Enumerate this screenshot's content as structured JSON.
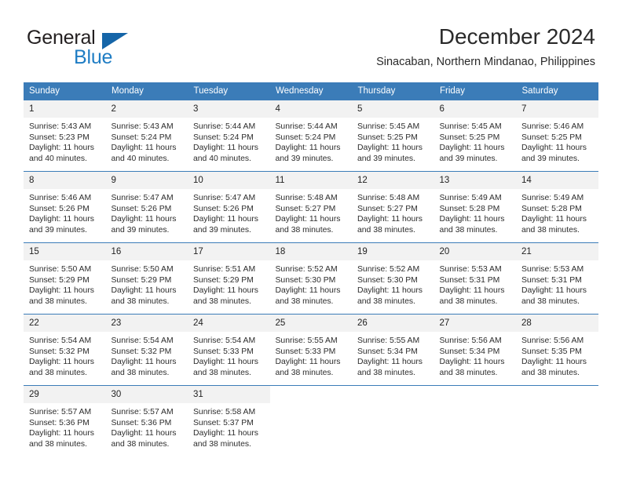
{
  "brand": {
    "name_part1": "General",
    "name_part2": "Blue",
    "accent_color": "#1f7dc4",
    "triangle_color": "#1565a8"
  },
  "header": {
    "title": "December 2024",
    "subtitle": "Sinacaban, Northern Mindanao, Philippines"
  },
  "calendar": {
    "header_bg": "#3b7cb8",
    "daynum_bg": "#f2f2f2",
    "weekday_headers": [
      "Sunday",
      "Monday",
      "Tuesday",
      "Wednesday",
      "Thursday",
      "Friday",
      "Saturday"
    ],
    "weeks": [
      [
        {
          "day": "1",
          "sunrise": "Sunrise: 5:43 AM",
          "sunset": "Sunset: 5:23 PM",
          "daylight1": "Daylight: 11 hours",
          "daylight2": "and 40 minutes."
        },
        {
          "day": "2",
          "sunrise": "Sunrise: 5:43 AM",
          "sunset": "Sunset: 5:24 PM",
          "daylight1": "Daylight: 11 hours",
          "daylight2": "and 40 minutes."
        },
        {
          "day": "3",
          "sunrise": "Sunrise: 5:44 AM",
          "sunset": "Sunset: 5:24 PM",
          "daylight1": "Daylight: 11 hours",
          "daylight2": "and 40 minutes."
        },
        {
          "day": "4",
          "sunrise": "Sunrise: 5:44 AM",
          "sunset": "Sunset: 5:24 PM",
          "daylight1": "Daylight: 11 hours",
          "daylight2": "and 39 minutes."
        },
        {
          "day": "5",
          "sunrise": "Sunrise: 5:45 AM",
          "sunset": "Sunset: 5:25 PM",
          "daylight1": "Daylight: 11 hours",
          "daylight2": "and 39 minutes."
        },
        {
          "day": "6",
          "sunrise": "Sunrise: 5:45 AM",
          "sunset": "Sunset: 5:25 PM",
          "daylight1": "Daylight: 11 hours",
          "daylight2": "and 39 minutes."
        },
        {
          "day": "7",
          "sunrise": "Sunrise: 5:46 AM",
          "sunset": "Sunset: 5:25 PM",
          "daylight1": "Daylight: 11 hours",
          "daylight2": "and 39 minutes."
        }
      ],
      [
        {
          "day": "8",
          "sunrise": "Sunrise: 5:46 AM",
          "sunset": "Sunset: 5:26 PM",
          "daylight1": "Daylight: 11 hours",
          "daylight2": "and 39 minutes."
        },
        {
          "day": "9",
          "sunrise": "Sunrise: 5:47 AM",
          "sunset": "Sunset: 5:26 PM",
          "daylight1": "Daylight: 11 hours",
          "daylight2": "and 39 minutes."
        },
        {
          "day": "10",
          "sunrise": "Sunrise: 5:47 AM",
          "sunset": "Sunset: 5:26 PM",
          "daylight1": "Daylight: 11 hours",
          "daylight2": "and 39 minutes."
        },
        {
          "day": "11",
          "sunrise": "Sunrise: 5:48 AM",
          "sunset": "Sunset: 5:27 PM",
          "daylight1": "Daylight: 11 hours",
          "daylight2": "and 38 minutes."
        },
        {
          "day": "12",
          "sunrise": "Sunrise: 5:48 AM",
          "sunset": "Sunset: 5:27 PM",
          "daylight1": "Daylight: 11 hours",
          "daylight2": "and 38 minutes."
        },
        {
          "day": "13",
          "sunrise": "Sunrise: 5:49 AM",
          "sunset": "Sunset: 5:28 PM",
          "daylight1": "Daylight: 11 hours",
          "daylight2": "and 38 minutes."
        },
        {
          "day": "14",
          "sunrise": "Sunrise: 5:49 AM",
          "sunset": "Sunset: 5:28 PM",
          "daylight1": "Daylight: 11 hours",
          "daylight2": "and 38 minutes."
        }
      ],
      [
        {
          "day": "15",
          "sunrise": "Sunrise: 5:50 AM",
          "sunset": "Sunset: 5:29 PM",
          "daylight1": "Daylight: 11 hours",
          "daylight2": "and 38 minutes."
        },
        {
          "day": "16",
          "sunrise": "Sunrise: 5:50 AM",
          "sunset": "Sunset: 5:29 PM",
          "daylight1": "Daylight: 11 hours",
          "daylight2": "and 38 minutes."
        },
        {
          "day": "17",
          "sunrise": "Sunrise: 5:51 AM",
          "sunset": "Sunset: 5:29 PM",
          "daylight1": "Daylight: 11 hours",
          "daylight2": "and 38 minutes."
        },
        {
          "day": "18",
          "sunrise": "Sunrise: 5:52 AM",
          "sunset": "Sunset: 5:30 PM",
          "daylight1": "Daylight: 11 hours",
          "daylight2": "and 38 minutes."
        },
        {
          "day": "19",
          "sunrise": "Sunrise: 5:52 AM",
          "sunset": "Sunset: 5:30 PM",
          "daylight1": "Daylight: 11 hours",
          "daylight2": "and 38 minutes."
        },
        {
          "day": "20",
          "sunrise": "Sunrise: 5:53 AM",
          "sunset": "Sunset: 5:31 PM",
          "daylight1": "Daylight: 11 hours",
          "daylight2": "and 38 minutes."
        },
        {
          "day": "21",
          "sunrise": "Sunrise: 5:53 AM",
          "sunset": "Sunset: 5:31 PM",
          "daylight1": "Daylight: 11 hours",
          "daylight2": "and 38 minutes."
        }
      ],
      [
        {
          "day": "22",
          "sunrise": "Sunrise: 5:54 AM",
          "sunset": "Sunset: 5:32 PM",
          "daylight1": "Daylight: 11 hours",
          "daylight2": "and 38 minutes."
        },
        {
          "day": "23",
          "sunrise": "Sunrise: 5:54 AM",
          "sunset": "Sunset: 5:32 PM",
          "daylight1": "Daylight: 11 hours",
          "daylight2": "and 38 minutes."
        },
        {
          "day": "24",
          "sunrise": "Sunrise: 5:54 AM",
          "sunset": "Sunset: 5:33 PM",
          "daylight1": "Daylight: 11 hours",
          "daylight2": "and 38 minutes."
        },
        {
          "day": "25",
          "sunrise": "Sunrise: 5:55 AM",
          "sunset": "Sunset: 5:33 PM",
          "daylight1": "Daylight: 11 hours",
          "daylight2": "and 38 minutes."
        },
        {
          "day": "26",
          "sunrise": "Sunrise: 5:55 AM",
          "sunset": "Sunset: 5:34 PM",
          "daylight1": "Daylight: 11 hours",
          "daylight2": "and 38 minutes."
        },
        {
          "day": "27",
          "sunrise": "Sunrise: 5:56 AM",
          "sunset": "Sunset: 5:34 PM",
          "daylight1": "Daylight: 11 hours",
          "daylight2": "and 38 minutes."
        },
        {
          "day": "28",
          "sunrise": "Sunrise: 5:56 AM",
          "sunset": "Sunset: 5:35 PM",
          "daylight1": "Daylight: 11 hours",
          "daylight2": "and 38 minutes."
        }
      ],
      [
        {
          "day": "29",
          "sunrise": "Sunrise: 5:57 AM",
          "sunset": "Sunset: 5:36 PM",
          "daylight1": "Daylight: 11 hours",
          "daylight2": "and 38 minutes."
        },
        {
          "day": "30",
          "sunrise": "Sunrise: 5:57 AM",
          "sunset": "Sunset: 5:36 PM",
          "daylight1": "Daylight: 11 hours",
          "daylight2": "and 38 minutes."
        },
        {
          "day": "31",
          "sunrise": "Sunrise: 5:58 AM",
          "sunset": "Sunset: 5:37 PM",
          "daylight1": "Daylight: 11 hours",
          "daylight2": "and 38 minutes."
        },
        {
          "day": "",
          "sunrise": "",
          "sunset": "",
          "daylight1": "",
          "daylight2": ""
        },
        {
          "day": "",
          "sunrise": "",
          "sunset": "",
          "daylight1": "",
          "daylight2": ""
        },
        {
          "day": "",
          "sunrise": "",
          "sunset": "",
          "daylight1": "",
          "daylight2": ""
        },
        {
          "day": "",
          "sunrise": "",
          "sunset": "",
          "daylight1": "",
          "daylight2": ""
        }
      ]
    ]
  }
}
